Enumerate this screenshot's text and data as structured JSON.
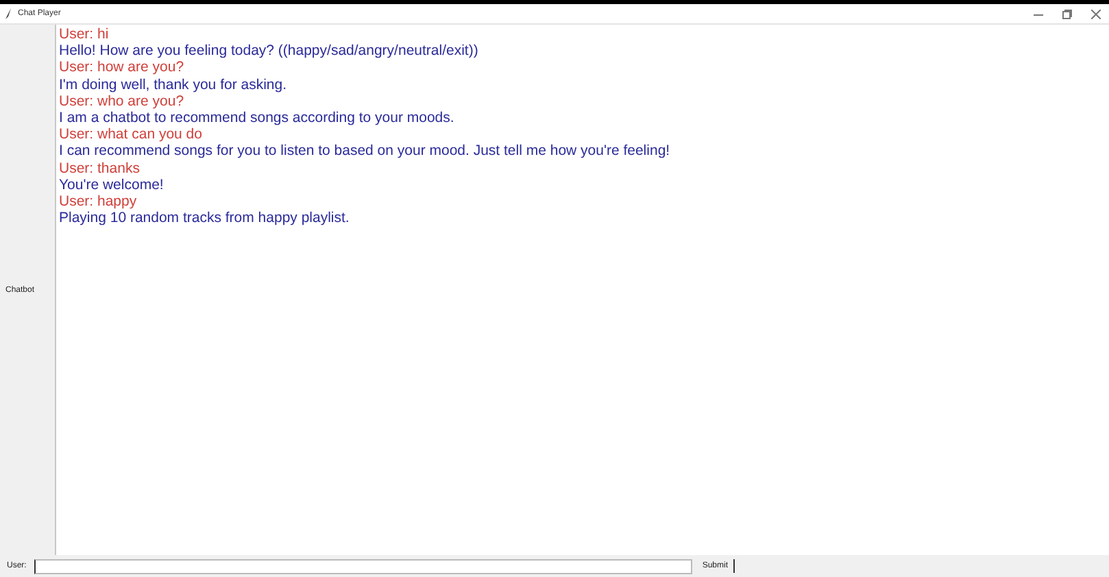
{
  "window": {
    "title": "Chat Player"
  },
  "chat_label": "Chatbot",
  "messages": [
    {
      "kind": "user",
      "text": "User: hi"
    },
    {
      "kind": "bot",
      "text": "Hello! How are you feeling today? ((happy/sad/angry/neutral/exit))"
    },
    {
      "kind": "user",
      "text": "User: how are you?"
    },
    {
      "kind": "bot",
      "text": "I'm doing well, thank you for asking."
    },
    {
      "kind": "user",
      "text": "User: who are you?"
    },
    {
      "kind": "bot",
      "text": "I am a chatbot to recommend songs according to your moods."
    },
    {
      "kind": "user",
      "text": "User: what can you do"
    },
    {
      "kind": "bot",
      "text": "I can recommend songs for you to listen to based on your mood. Just tell me how you're feeling!"
    },
    {
      "kind": "user",
      "text": "User: thanks"
    },
    {
      "kind": "bot",
      "text": "You're welcome!"
    },
    {
      "kind": "user",
      "text": "User: happy"
    },
    {
      "kind": "bot",
      "text": "Playing 10 random tracks from happy playlist."
    }
  ],
  "input": {
    "label": "User:"
  },
  "submit_button": "Submit"
}
